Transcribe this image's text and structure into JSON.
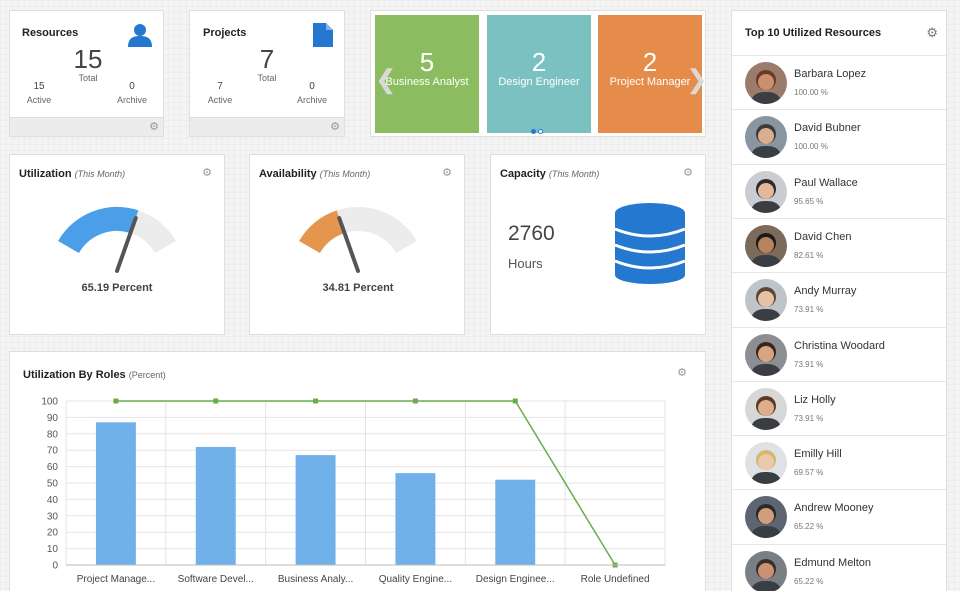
{
  "resources": {
    "title": "Resources",
    "total": "15",
    "total_label": "Total",
    "active": "15",
    "active_label": "Active",
    "archive": "0",
    "archive_label": "Archive",
    "icon": "user-icon"
  },
  "projects": {
    "title": "Projects",
    "total": "7",
    "total_label": "Total",
    "active": "7",
    "active_label": "Active",
    "archive": "0",
    "archive_label": "Archive",
    "icon": "document-icon"
  },
  "carousel": {
    "tiles": [
      {
        "count": "5",
        "label": "Business Analyst",
        "color": "#8bbd60"
      },
      {
        "count": "2",
        "label": "Design Engineer",
        "color": "#7bc1c1"
      },
      {
        "count": "2",
        "label": "Project Manager",
        "color": "#e58c4a"
      }
    ]
  },
  "utilization": {
    "title": "Utilization",
    "subtitle": "(This Month)",
    "value": 65.19,
    "value_text": "65.19 Percent",
    "color": "#4a9fe8"
  },
  "availability": {
    "title": "Availability",
    "subtitle": "(This Month)",
    "value": 34.81,
    "value_text": "34.81 Percent",
    "color": "#e5964e"
  },
  "capacity": {
    "title": "Capacity",
    "subtitle": "(This Month)",
    "value": "2760",
    "unit": "Hours",
    "icon": "database-icon",
    "color": "#2478d0"
  },
  "top10": {
    "title": "Top 10 Utilized Resources",
    "items": [
      {
        "name": "Barbara Lopez",
        "pct": "100.00 %"
      },
      {
        "name": "David Bubner",
        "pct": "100.00 %"
      },
      {
        "name": "Paul Wallace",
        "pct": "95.65 %"
      },
      {
        "name": "David Chen",
        "pct": "82.61 %"
      },
      {
        "name": "Andy Murray",
        "pct": "73.91 %"
      },
      {
        "name": "Christina Woodard",
        "pct": "73.91 %"
      },
      {
        "name": "Liz Holly",
        "pct": "73.91 %"
      },
      {
        "name": "Emilly Hill",
        "pct": "69.57 %"
      },
      {
        "name": "Andrew Mooney",
        "pct": "65.22 %"
      },
      {
        "name": "Edmund Melton",
        "pct": "65.22 %"
      }
    ]
  },
  "roles_chart": {
    "title": "Utilization By Roles",
    "subtitle": "(Percent)"
  },
  "chart_data": {
    "type": "bar",
    "categories": [
      "Project Manage...",
      "Software Devel...",
      "Business Analy...",
      "Quality Engine...",
      "Design Enginee...",
      "Role Undefined"
    ],
    "series": [
      {
        "type": "bar",
        "values": [
          87,
          72,
          67,
          56,
          52,
          0
        ],
        "color": "#6fb1e8"
      },
      {
        "type": "line",
        "values": [
          100,
          100,
          100,
          100,
          100,
          0
        ],
        "color": "#6aab4d"
      }
    ],
    "yticks": [
      0,
      10,
      20,
      30,
      40,
      50,
      60,
      70,
      80,
      90,
      100
    ],
    "ylim": [
      0,
      100
    ],
    "grid": true
  }
}
